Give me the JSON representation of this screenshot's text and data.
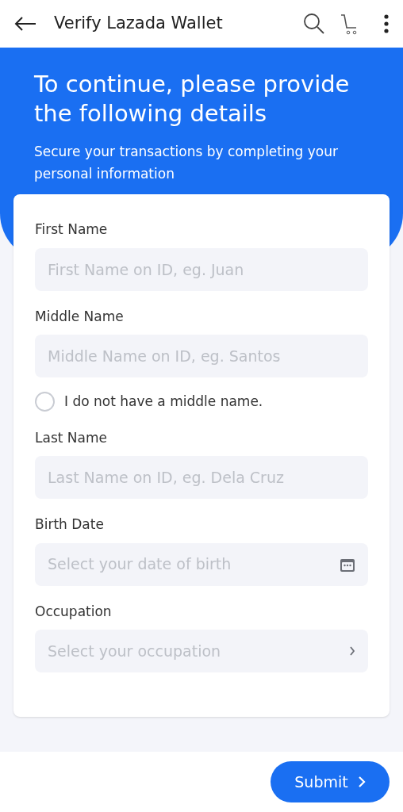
{
  "header": {
    "title": "Verify Lazada Wallet"
  },
  "banner": {
    "heading": "To continue, please provide the following details",
    "subtitle": "Secure your transactions by completing your personal information"
  },
  "form": [
    {
      "kind": "input",
      "label": "First Name",
      "placeholder": "First Name on ID, eg. Juan"
    },
    {
      "kind": "input",
      "label": "Middle Name",
      "placeholder": "Middle Name on ID, eg. Santos"
    },
    {
      "kind": "checkbox",
      "label": "I do not have a middle name.",
      "checked": false
    },
    {
      "kind": "input",
      "label": "Last Name",
      "placeholder": "Last Name on ID, eg. Dela Cruz"
    },
    {
      "kind": "date",
      "label": "Birth Date",
      "placeholder": "Select your date of birth"
    },
    {
      "kind": "select",
      "label": "Occupation",
      "placeholder": "Select your occupation"
    }
  ],
  "submit": {
    "label": "Submit"
  }
}
